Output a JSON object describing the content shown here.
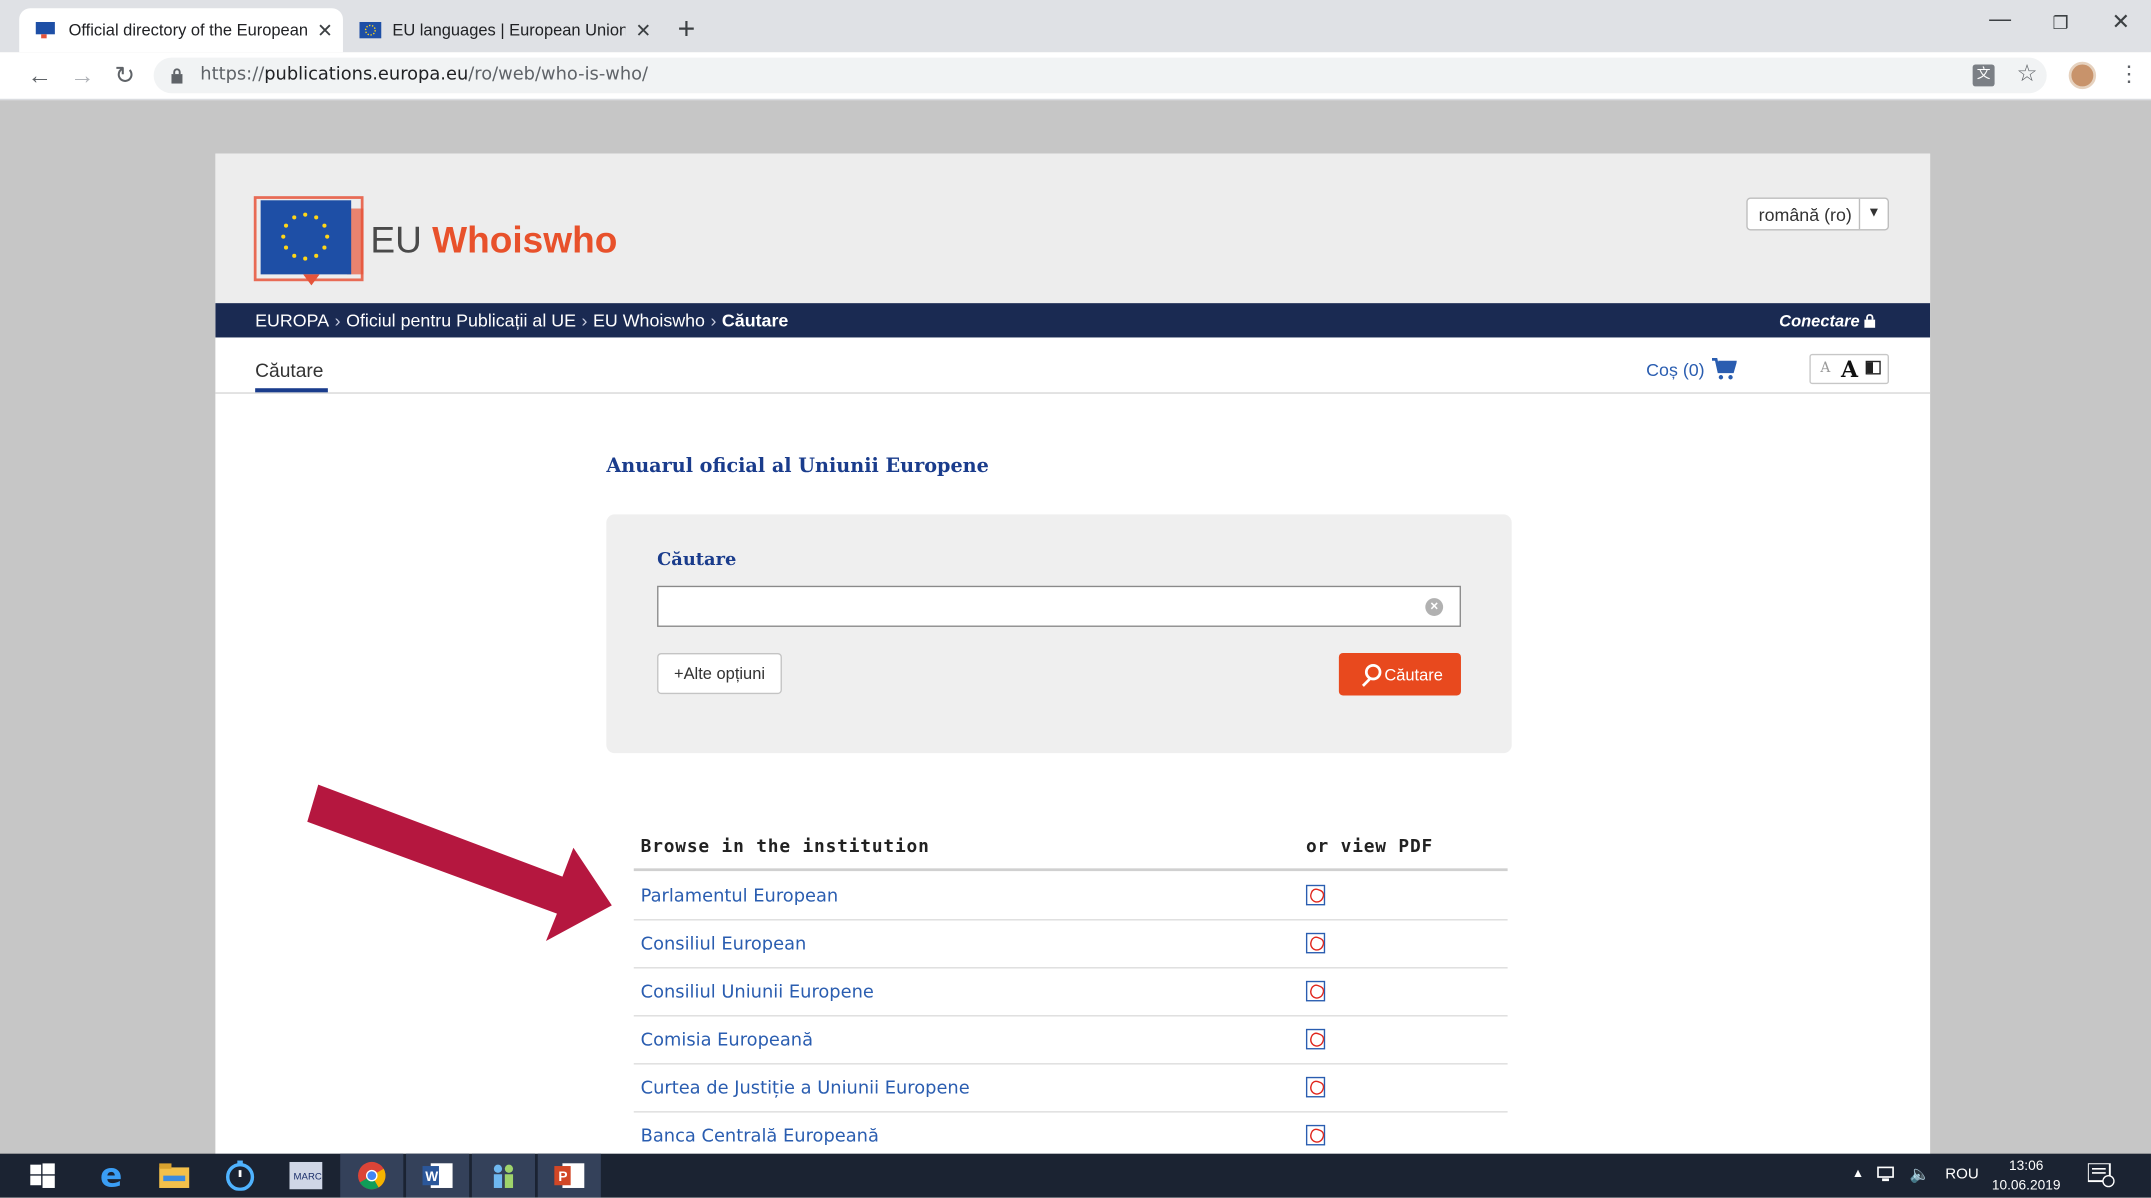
{
  "browser": {
    "tabs": [
      {
        "title": "Official directory of the European"
      },
      {
        "title": "EU languages | European Union"
      }
    ],
    "url": {
      "scheme": "https://",
      "host": "publications.europa.eu",
      "path": "/ro/web/who-is-who/"
    }
  },
  "site": {
    "brand_prefix": "EU",
    "brand_name": "Whoiswho",
    "language_select": "română (ro)",
    "breadcrumb": [
      "EUROPA",
      "Oficiul pentru Publicații al UE",
      "EU Whoiswho",
      "Căutare"
    ],
    "login": "Conectare",
    "nav_tab": "Căutare",
    "cart": "Coș (0)",
    "text_size": {
      "small": "A",
      "large": "A"
    }
  },
  "main": {
    "title": "Anuarul oficial al Uniunii Europene",
    "search": {
      "label": "Căutare",
      "value": "",
      "clear_icon": "×",
      "more_options": "+Alte opțiuni",
      "button": "Căutare"
    },
    "table": {
      "col_institution": "Browse in the institution",
      "col_pdf": "or view PDF",
      "rows": [
        {
          "name": "Parlamentul European"
        },
        {
          "name": "Consiliul European"
        },
        {
          "name": "Consiliul Uniunii Europene"
        },
        {
          "name": "Comisia Europeană"
        },
        {
          "name": "Curtea de Justiție a Uniunii Europene"
        },
        {
          "name": "Banca Centrală Europeană"
        }
      ]
    }
  },
  "annotation_arrow_color": "#b5173f",
  "taskbar": {
    "apps": [
      "windows-start-icon",
      "edge-icon",
      "file-explorer-icon",
      "timer-app-icon",
      "marc-app-icon",
      "chrome-icon",
      "word-icon",
      "teams-like-icon",
      "powerpoint-icon"
    ],
    "language": "ROU",
    "time": "13:06",
    "date": "10.06.2019"
  }
}
